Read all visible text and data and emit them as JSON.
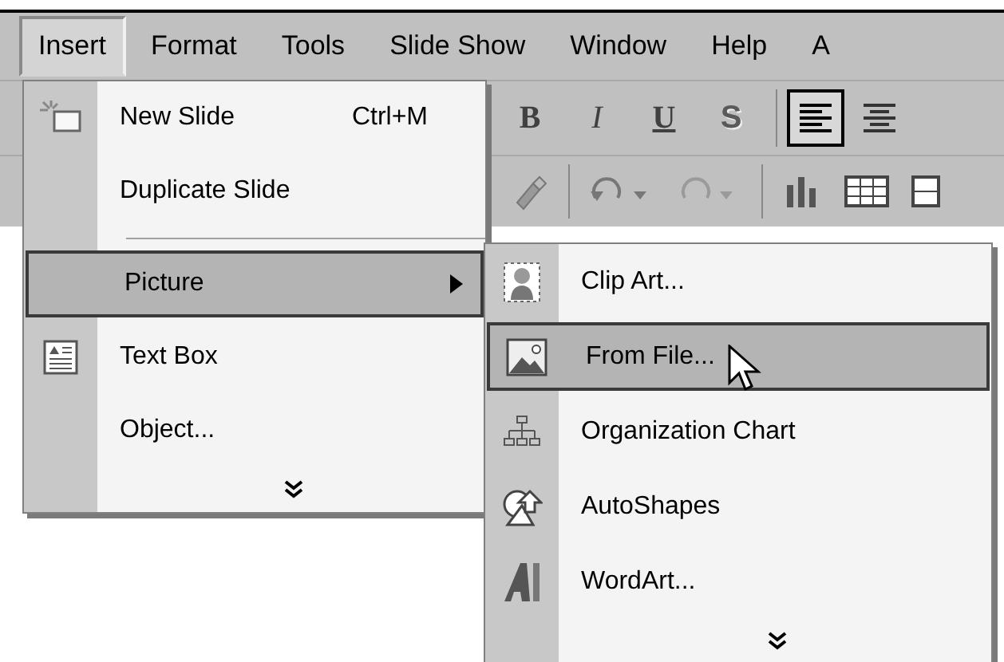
{
  "menu_bar": [
    {
      "label": "Insert",
      "selected": true
    },
    {
      "label": "Format",
      "selected": false
    },
    {
      "label": "Tools",
      "selected": false
    },
    {
      "label": "Slide Show",
      "selected": false
    },
    {
      "label": "Window",
      "selected": false
    },
    {
      "label": "Help",
      "selected": false
    },
    {
      "label": "A",
      "selected": false
    }
  ],
  "toolbar": {
    "format_buttons": [
      {
        "label": "B",
        "kind": "bold"
      },
      {
        "label": "I",
        "kind": "italic"
      },
      {
        "label": "U",
        "kind": "underline"
      },
      {
        "label": "S",
        "kind": "shadow"
      }
    ],
    "align_buttons": [
      {
        "kind": "left",
        "selected": true
      },
      {
        "kind": "center",
        "selected": false
      }
    ]
  },
  "insert_menu": {
    "items": [
      {
        "kind": "command",
        "label": "New Slide",
        "shortcut": "Ctrl+M",
        "selected": false
      },
      {
        "kind": "command",
        "label": "Duplicate Slide",
        "selected": false
      },
      {
        "kind": "separator"
      },
      {
        "kind": "submenu",
        "label": "Picture",
        "selected": true
      },
      {
        "kind": "command",
        "label": "Text Box",
        "selected": false
      },
      {
        "kind": "command",
        "label": "Object...",
        "selected": false
      },
      {
        "kind": "expand"
      }
    ]
  },
  "picture_submenu": {
    "items": [
      {
        "kind": "command",
        "label": "Clip Art...",
        "selected": false
      },
      {
        "kind": "command",
        "label": "From File...",
        "selected": true
      },
      {
        "kind": "command",
        "label": "Organization Chart",
        "selected": false
      },
      {
        "kind": "command",
        "label": "AutoShapes",
        "selected": false
      },
      {
        "kind": "command",
        "label": "WordArt...",
        "selected": false
      },
      {
        "kind": "expand"
      }
    ]
  }
}
